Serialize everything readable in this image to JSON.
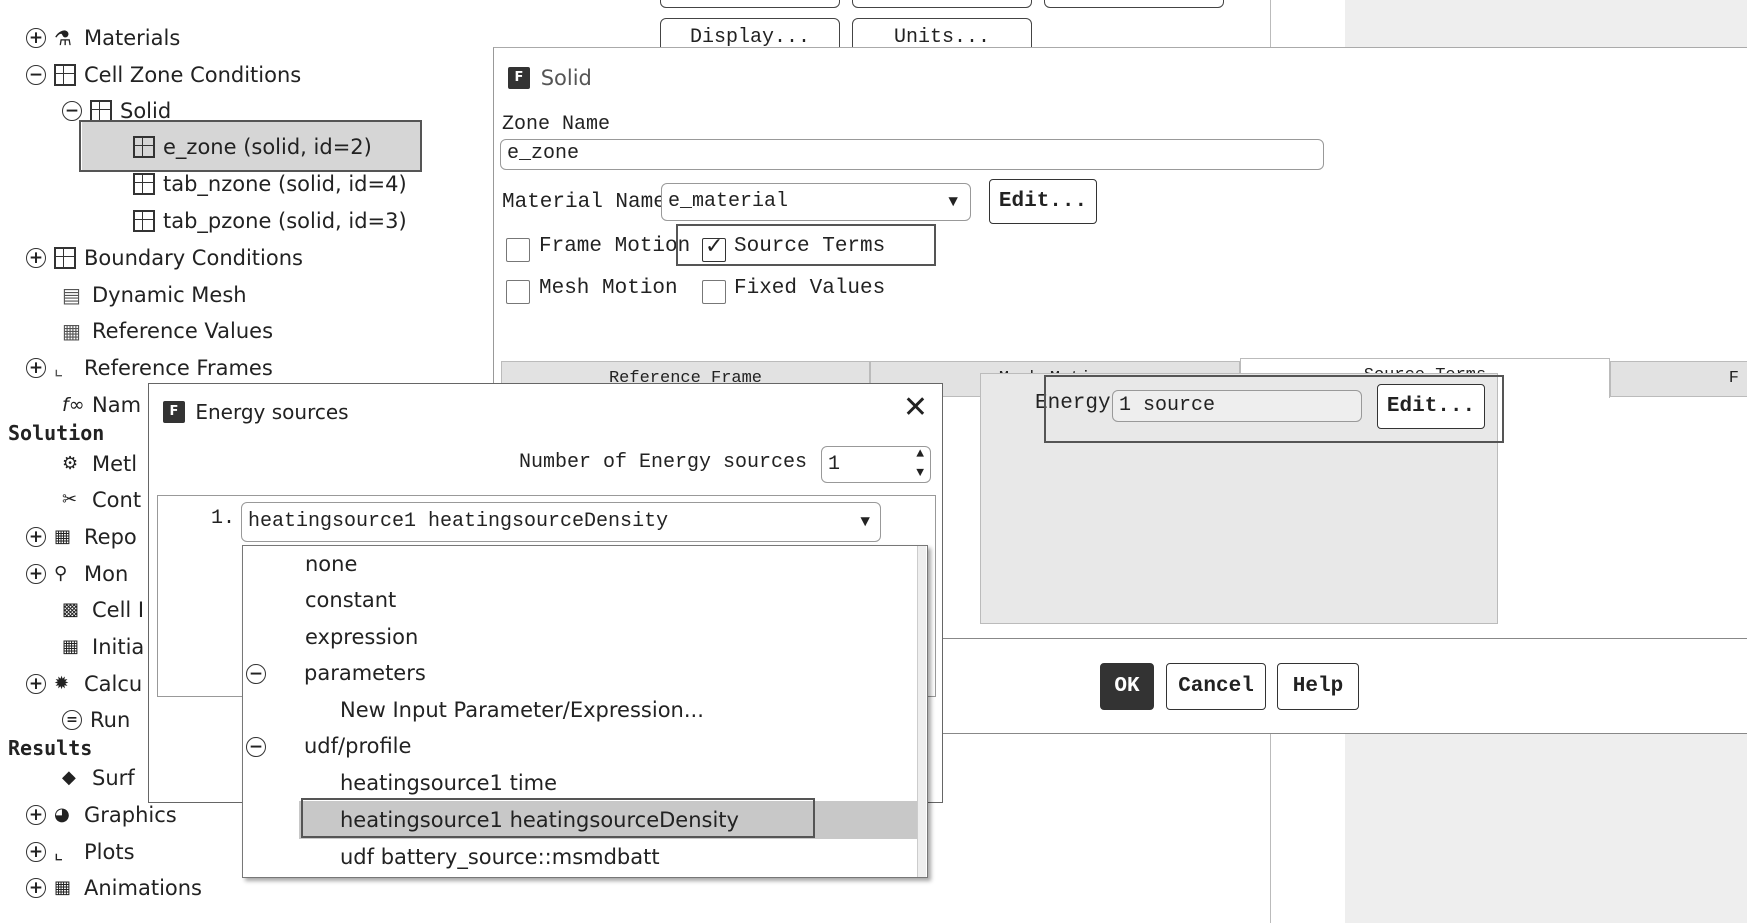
{
  "tree": {
    "materials": "Materials",
    "cell_zone_conditions": "Cell Zone Conditions",
    "solid": "Solid",
    "e_zone": "e_zone (solid, id=2)",
    "tab_nzone": "tab_nzone (solid, id=4)",
    "tab_pzone": "tab_pzone (solid, id=3)",
    "boundary_conditions": "Boundary Conditions",
    "dynamic_mesh": "Dynamic Mesh",
    "reference_values": "Reference Values",
    "reference_frames": "Reference Frames",
    "named": "Nam",
    "solution": "Solution",
    "methods": "Metl",
    "controls": "Cont",
    "report": "Repo",
    "monitors": "Mon",
    "cell": "Cell I",
    "initialization": "Initia",
    "calculation": "Calcu",
    "run": "Run",
    "results": "Results",
    "surfaces": "Surf",
    "graphics": "Graphics",
    "plots": "Plots",
    "animations": "Animations"
  },
  "top_buttons": {
    "display": "Display...",
    "units": "Units..."
  },
  "solid_dialog": {
    "title": "Solid",
    "icon_letter": "F",
    "zone_name_label": "Zone Name",
    "zone_name_value": "e_zone",
    "material_name_label": "Material Name",
    "material_name_value": "e_material",
    "edit_button": "Edit...",
    "frame_motion": "Frame Motion",
    "source_terms": "Source Terms",
    "mesh_motion": "Mesh Motion",
    "fixed_values": "Fixed Values",
    "tabs": [
      "Reference Frame",
      "Mesh Motion",
      "Source Terms",
      "F"
    ],
    "energy_label": "Energy",
    "energy_value": "1 source",
    "energy_edit": "Edit...",
    "ok": "OK",
    "cancel": "Cancel",
    "help": "Help",
    "source_terms_checked": true
  },
  "energy_dialog": {
    "title": "Energy sources",
    "icon_letter": "F",
    "count_label": "Number of Energy sources",
    "count_value": "1",
    "row_index": "1.",
    "selected_value": "heatingsource1 heatingsourceDensity",
    "options": {
      "none": "none",
      "constant": "constant",
      "expression": "expression",
      "parameters": "parameters",
      "new_param": "New Input Parameter/Expression...",
      "udf_profile": "udf/profile",
      "hs_time": "heatingsource1 time",
      "hs_density": "heatingsource1 heatingsourceDensity",
      "udf_battery": "udf battery_source::msmdbatt"
    }
  }
}
